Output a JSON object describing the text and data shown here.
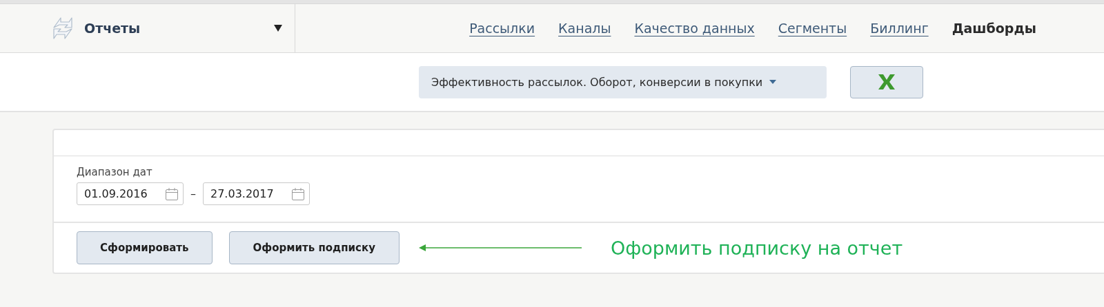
{
  "header": {
    "section": {
      "label": "Отчеты"
    },
    "nav": [
      {
        "label": "Рассылки",
        "selected": false
      },
      {
        "label": "Каналы",
        "selected": false
      },
      {
        "label": "Качество данных",
        "selected": false
      },
      {
        "label": "Сегменты",
        "selected": false
      },
      {
        "label": "Биллинг",
        "selected": false
      },
      {
        "label": "Дашборды",
        "selected": true
      }
    ]
  },
  "toolbar": {
    "report_select": {
      "value": "Эффективность рассылок. Оборот, конверсии в покупки"
    }
  },
  "form": {
    "date_range": {
      "label": "Диапазон дат",
      "from": "01.09.2016",
      "separator": "–",
      "to": "27.03.2017"
    },
    "buttons": [
      "Сформировать",
      "Оформить подписку"
    ]
  },
  "annotation": {
    "text": "Оформить подписку на отчет"
  }
}
